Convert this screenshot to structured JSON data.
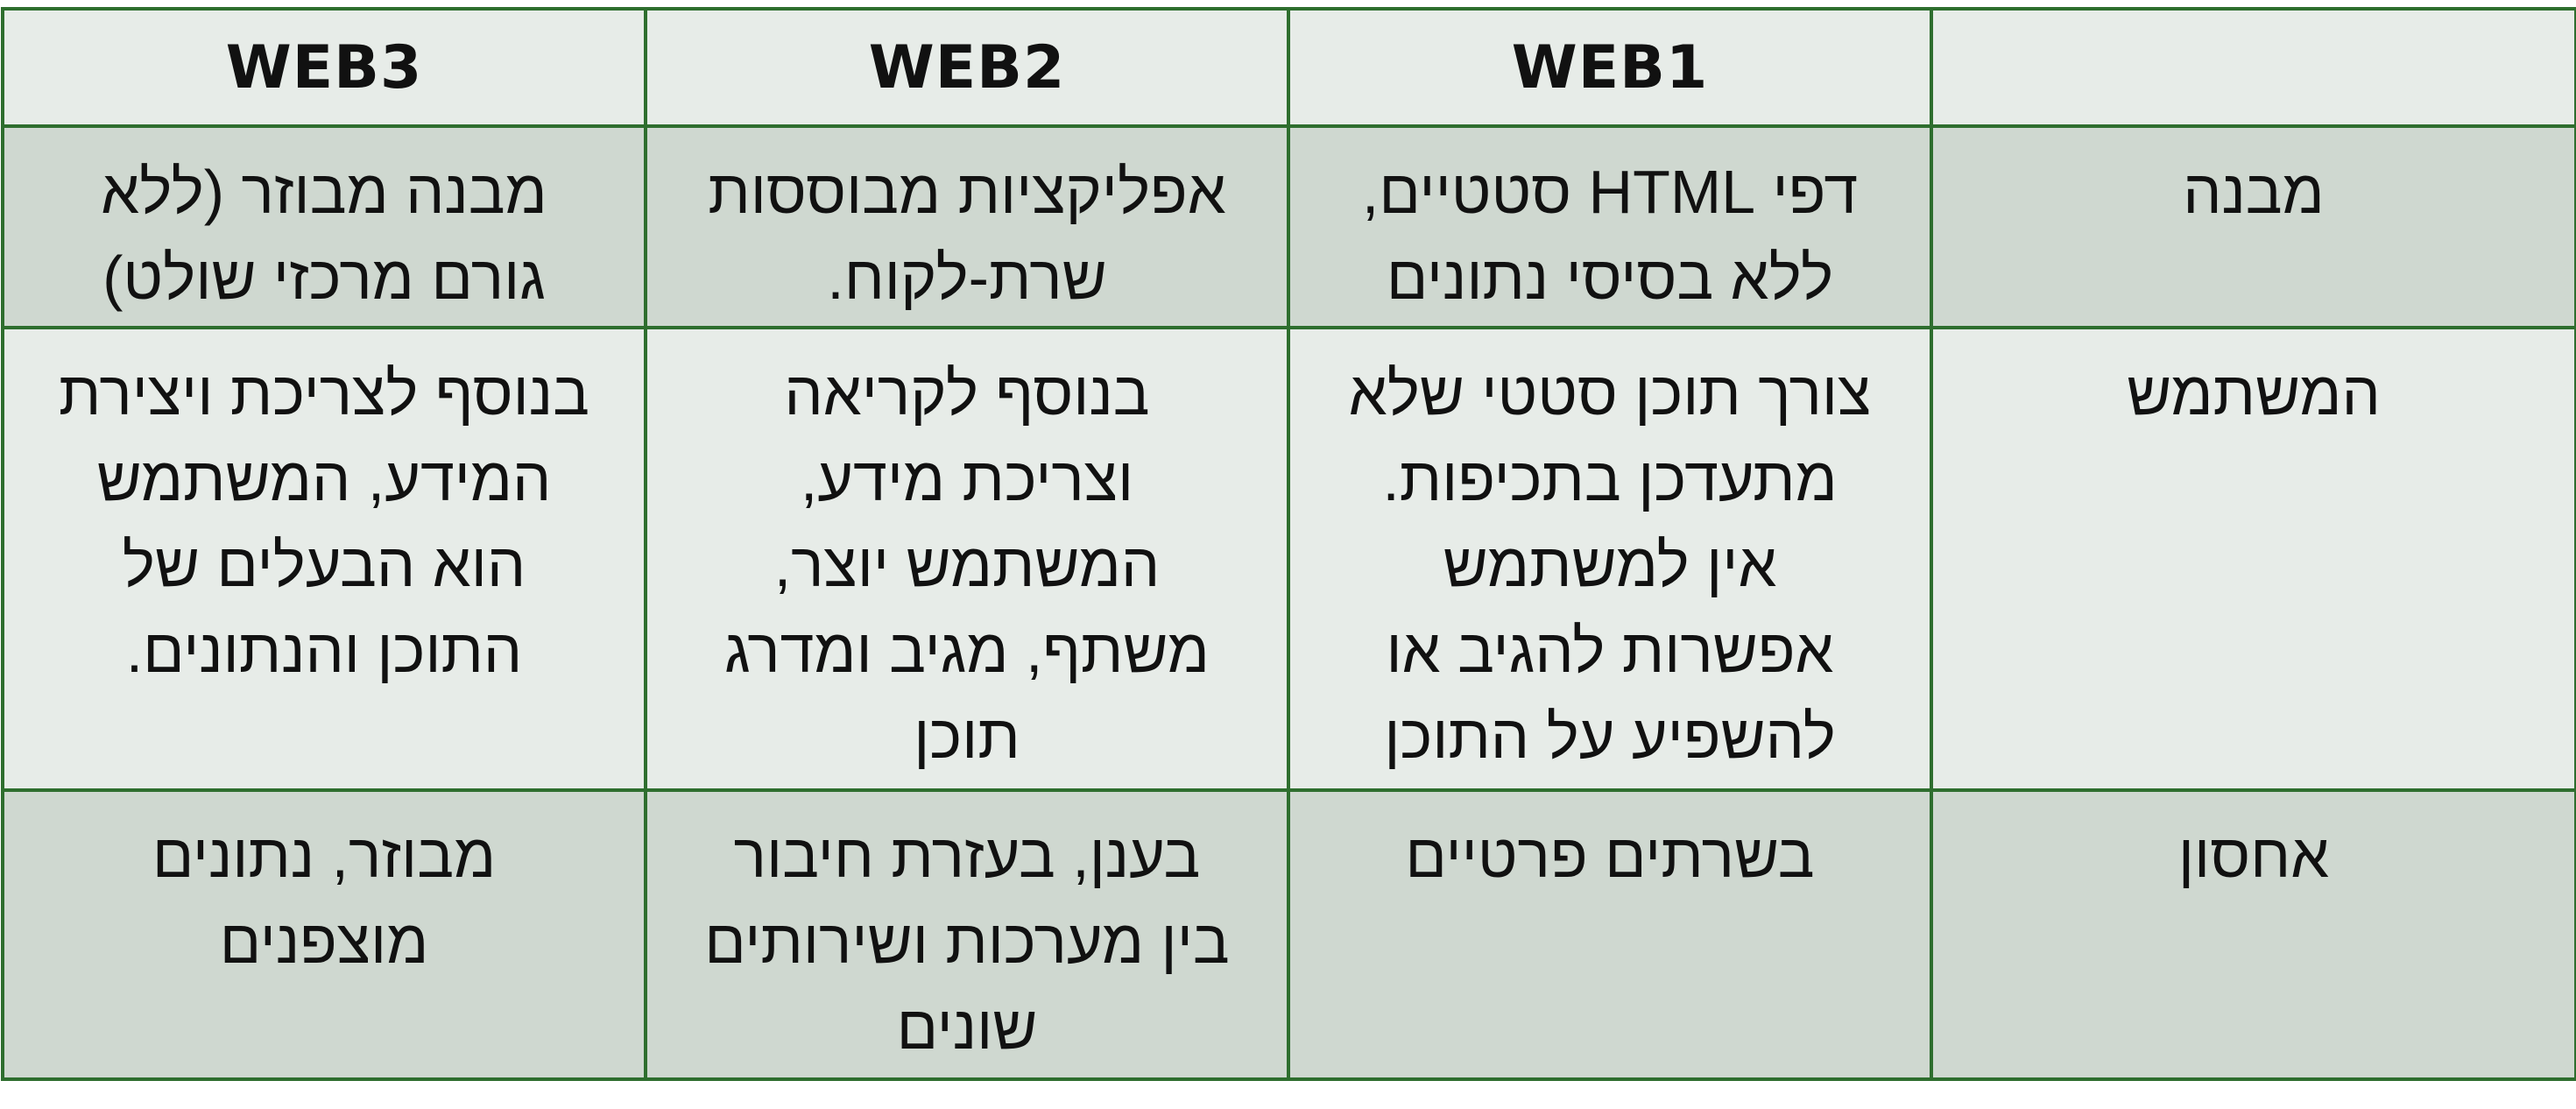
{
  "table": {
    "header": {
      "empty": "",
      "web1": "WEB1",
      "web2": "WEB2",
      "web3": "WEB3"
    },
    "rows": [
      {
        "label": "מבנה",
        "web1": "דפי  HTML סטטיים,\nללא בסיסי נתונים",
        "web2": "אפליקציות מבוססות\nשרת-לקוח.",
        "web3": "מבנה מבוזר (ללא\nגורם מרכזי שולט)"
      },
      {
        "label": "המשתמש",
        "web1": "צורך תוכן סטטי שלא\nמתעדכן בתכיפות.\nאין למשתמש\nאפשרות להגיב או\nלהשפיע על התוכן",
        "web2": "בנוסף לקריאה\nוצריכת מידע,\nהמשתמש יוצר,\nמשתף, מגיב ומדרג\nתוכן",
        "web3": "בנוסף לצריכת ויצירת\nהמידע, המשתמש\nהוא הבעלים של\nהתוכן והנתונים."
      },
      {
        "label": "אחסון",
        "web1": "בשרתים פרטיים",
        "web2": "בענן, בעזרת חיבור\nבין מערכות ושירותים\nשונים",
        "web3": "מבוזר, נתונים\nמוצפנים"
      }
    ]
  },
  "colors": {
    "border": "#2e6e2e",
    "header_bg": "#e7ece8",
    "row_dark_bg": "#cfd8d0",
    "row_light_bg": "#e7ece8"
  }
}
